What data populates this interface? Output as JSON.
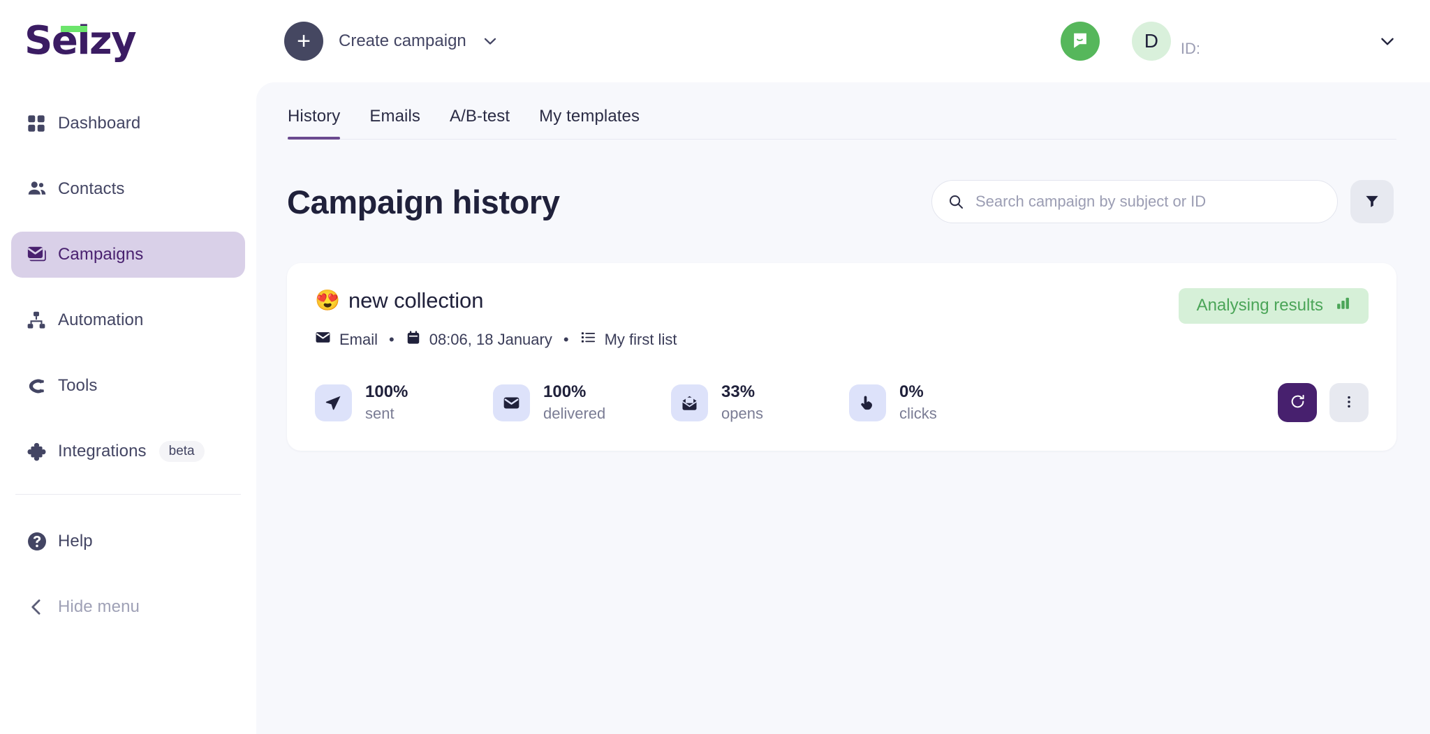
{
  "brand": {
    "logo_text": "Selzy",
    "logo_color": "#3b1c63",
    "accent_green": "#6ce56c"
  },
  "topbar": {
    "create_label": "Create campaign",
    "plus_label": "+",
    "account_letter": "D",
    "account_id_label": "ID:"
  },
  "sidebar": {
    "items": [
      {
        "label": "Dashboard",
        "icon": "grid-icon",
        "active": false
      },
      {
        "label": "Contacts",
        "icon": "people-icon",
        "active": false
      },
      {
        "label": "Campaigns",
        "icon": "envelope-stack-icon",
        "active": true
      },
      {
        "label": "Automation",
        "icon": "sitemap-icon",
        "active": false
      },
      {
        "label": "Tools",
        "icon": "tools-c-icon",
        "active": false
      },
      {
        "label": "Integrations",
        "icon": "puzzle-icon",
        "active": false,
        "badge": "beta"
      }
    ],
    "help_label": "Help",
    "hide_menu_label": "Hide menu"
  },
  "main": {
    "tabs": [
      {
        "label": "History",
        "active": true
      },
      {
        "label": "Emails",
        "active": false
      },
      {
        "label": "A/B-test",
        "active": false
      },
      {
        "label": "My templates",
        "active": false
      }
    ],
    "page_title": "Campaign history",
    "search": {
      "placeholder": "Search campaign by subject or ID",
      "value": ""
    },
    "filter_button": "filter-icon"
  },
  "campaign": {
    "emoji": "😍",
    "name": "new collection",
    "meta": {
      "channel": "Email",
      "datetime": "08:06, 18 January",
      "list": "My first list",
      "separator": "•"
    },
    "status": {
      "label": "Analysing results",
      "color": "#4ba558",
      "background": "#d6f0d8"
    },
    "metrics": [
      {
        "value": "100%",
        "label": "sent",
        "icon": "send-icon"
      },
      {
        "value": "100%",
        "label": "delivered",
        "icon": "envelope-icon"
      },
      {
        "value": "33%",
        "label": "opens",
        "icon": "open-envelope-icon"
      },
      {
        "value": "0%",
        "label": "clicks",
        "icon": "click-hand-icon"
      }
    ],
    "actions": [
      {
        "name": "repeat",
        "icon": "refresh-icon"
      },
      {
        "name": "more",
        "icon": "more-vertical-icon"
      }
    ]
  }
}
